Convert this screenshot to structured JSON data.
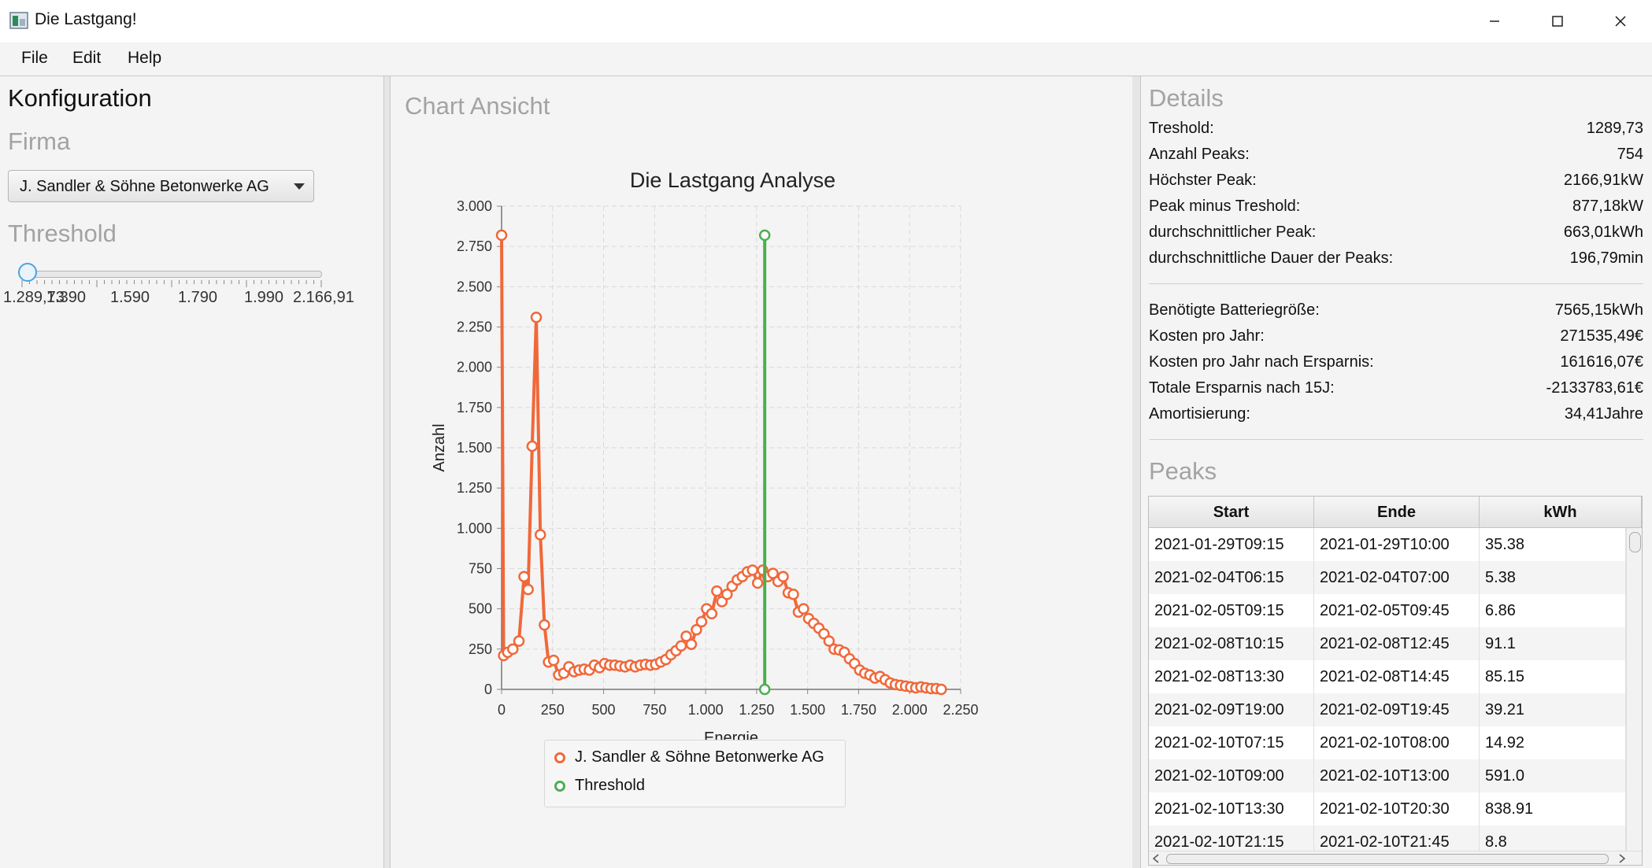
{
  "window": {
    "title": "Die Lastgang!"
  },
  "menu": [
    "File",
    "Edit",
    "Help"
  ],
  "left": {
    "heading": "Konfiguration",
    "firma_label": "Firma",
    "firma_value": "J. Sandler & Söhne Betonwerke AG",
    "threshold_label": "Threshold",
    "slider": {
      "value": 1289.73,
      "min_label": "1.289,73",
      "ticks": [
        "1.390",
        "1.590",
        "1.790",
        "1.990"
      ],
      "max_label": "2.166,91"
    }
  },
  "middle": {
    "heading": "Chart Ansicht"
  },
  "chart_data": {
    "type": "line",
    "title": "Die Lastgang Analyse",
    "xlabel": "Energie",
    "ylabel": "Anzahl",
    "xlim": [
      0,
      2250
    ],
    "ylim": [
      0,
      3000
    ],
    "x_ticks": [
      "0",
      "250",
      "500",
      "750",
      "1.000",
      "1.250",
      "1.500",
      "1.750",
      "2.000",
      "2.250"
    ],
    "y_ticks": [
      "0",
      "250",
      "500",
      "750",
      "1.000",
      "1.250",
      "1.500",
      "1.750",
      "2.000",
      "2.250",
      "2.500",
      "2.750",
      "3.000"
    ],
    "grid": true,
    "legend_position": "bottom",
    "series": [
      {
        "name": "J. Sandler & Söhne Betonwerke AG",
        "color": "#f0683a",
        "x": [
          0,
          10,
          30,
          55,
          85,
          110,
          130,
          150,
          170,
          190,
          210,
          230,
          255,
          280,
          305,
          330,
          355,
          380,
          405,
          430,
          455,
          480,
          505,
          530,
          555,
          580,
          605,
          630,
          655,
          680,
          705,
          730,
          755,
          780,
          805,
          830,
          855,
          880,
          905,
          930,
          955,
          980,
          1005,
          1030,
          1055,
          1080,
          1105,
          1130,
          1155,
          1180,
          1205,
          1230,
          1255,
          1280,
          1305,
          1330,
          1355,
          1380,
          1405,
          1430,
          1455,
          1480,
          1505,
          1530,
          1555,
          1580,
          1605,
          1630,
          1655,
          1680,
          1705,
          1730,
          1755,
          1780,
          1805,
          1830,
          1855,
          1880,
          1905,
          1930,
          1955,
          1980,
          2005,
          2030,
          2055,
          2080,
          2105,
          2130,
          2155
        ],
        "y": [
          2820,
          210,
          230,
          250,
          300,
          700,
          620,
          1510,
          2310,
          960,
          400,
          170,
          180,
          90,
          100,
          140,
          110,
          120,
          125,
          120,
          150,
          135,
          160,
          150,
          150,
          145,
          140,
          150,
          140,
          150,
          155,
          150,
          155,
          170,
          185,
          215,
          240,
          270,
          330,
          280,
          370,
          420,
          500,
          470,
          610,
          545,
          590,
          640,
          680,
          700,
          730,
          740,
          660,
          740,
          700,
          720,
          670,
          700,
          600,
          590,
          480,
          500,
          440,
          410,
          380,
          345,
          300,
          250,
          245,
          230,
          190,
          160,
          120,
          100,
          90,
          70,
          80,
          60,
          40,
          30,
          25,
          20,
          15,
          10,
          15,
          10,
          5,
          5,
          0
        ]
      },
      {
        "name": "Threshold",
        "color": "#4caf50",
        "x": [
          1289.73,
          1289.73
        ],
        "y": [
          2820,
          0
        ]
      }
    ]
  },
  "details": {
    "heading": "Details",
    "rows": [
      {
        "k": "Treshold:",
        "v": "1289,73"
      },
      {
        "k": "Anzahl Peaks:",
        "v": "754"
      },
      {
        "k": "Höchster Peak:",
        "v": "2166,91kW"
      },
      {
        "k": "Peak minus Treshold:",
        "v": "877,18kW"
      },
      {
        "k": "durchschnittlicher Peak:",
        "v": "663,01kWh"
      },
      {
        "k": "durchschnittliche Dauer der Peaks:",
        "v": "196,79min"
      }
    ],
    "rows2": [
      {
        "k": "Benötigte Batteriegröße:",
        "v": "7565,15kWh"
      },
      {
        "k": "Kosten pro Jahr:",
        "v": "271535,49€"
      },
      {
        "k": "Kosten pro Jahr nach Ersparnis:",
        "v": "161616,07€"
      },
      {
        "k": "Totale Ersparnis nach 15J:",
        "v": "-2133783,61€"
      },
      {
        "k": "Amortisierung:",
        "v": "34,41Jahre"
      }
    ]
  },
  "peaks": {
    "heading": "Peaks",
    "columns": [
      "Start",
      "Ende",
      "kWh"
    ],
    "rows": [
      [
        "2021-01-29T09:15",
        "2021-01-29T10:00",
        "35.38"
      ],
      [
        "2021-02-04T06:15",
        "2021-02-04T07:00",
        "5.38"
      ],
      [
        "2021-02-05T09:15",
        "2021-02-05T09:45",
        "6.86"
      ],
      [
        "2021-02-08T10:15",
        "2021-02-08T12:45",
        "91.1"
      ],
      [
        "2021-02-08T13:30",
        "2021-02-08T14:45",
        "85.15"
      ],
      [
        "2021-02-09T19:00",
        "2021-02-09T19:45",
        "39.21"
      ],
      [
        "2021-02-10T07:15",
        "2021-02-10T08:00",
        "14.92"
      ],
      [
        "2021-02-10T09:00",
        "2021-02-10T13:00",
        "591.0"
      ],
      [
        "2021-02-10T13:30",
        "2021-02-10T20:30",
        "838.91"
      ],
      [
        "2021-02-10T21:15",
        "2021-02-10T21:45",
        "8.8"
      ]
    ]
  }
}
